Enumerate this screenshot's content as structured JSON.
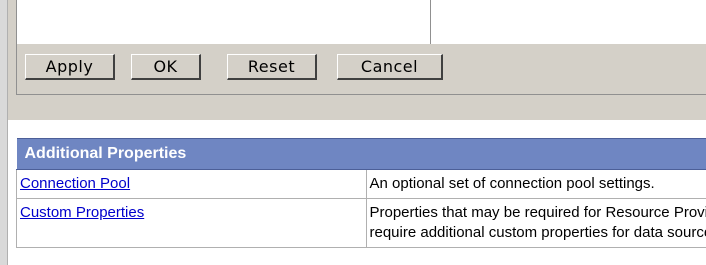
{
  "buttons": {
    "apply": "Apply",
    "ok": "OK",
    "reset": "Reset",
    "cancel": "Cancel"
  },
  "additional_properties": {
    "header": "Additional Properties",
    "rows": [
      {
        "name": "Connection Pool",
        "description_lines": [
          "An optional set of connection pool settings."
        ]
      },
      {
        "name": "Custom Properties",
        "description_lines": [
          "Properties that may be required for Resource Providers",
          "require additional custom properties for data sources th"
        ]
      }
    ]
  },
  "colors": {
    "header_bg": "#6f86c2",
    "link": "#0000cc",
    "panel_bg": "#d4d0c8"
  }
}
